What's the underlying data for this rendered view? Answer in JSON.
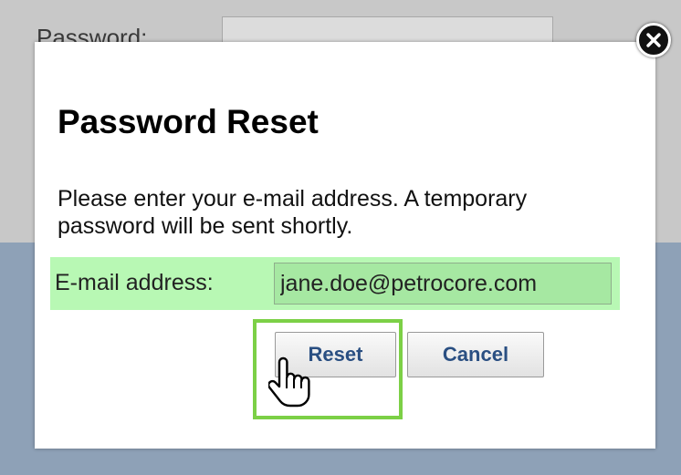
{
  "background": {
    "password_label": "Password:"
  },
  "modal": {
    "title": "Password Reset",
    "description": "Please enter your e-mail address. A temporary password will be sent shortly.",
    "email_label": "E-mail address:",
    "email_value": "jane.doe@petrocore.com",
    "reset_label": "Reset",
    "cancel_label": "Cancel",
    "close_icon": "close-icon"
  },
  "colors": {
    "highlight_row": "#b8f8b4",
    "highlight_outline": "#7cd046",
    "button_text": "#2a4f82"
  }
}
